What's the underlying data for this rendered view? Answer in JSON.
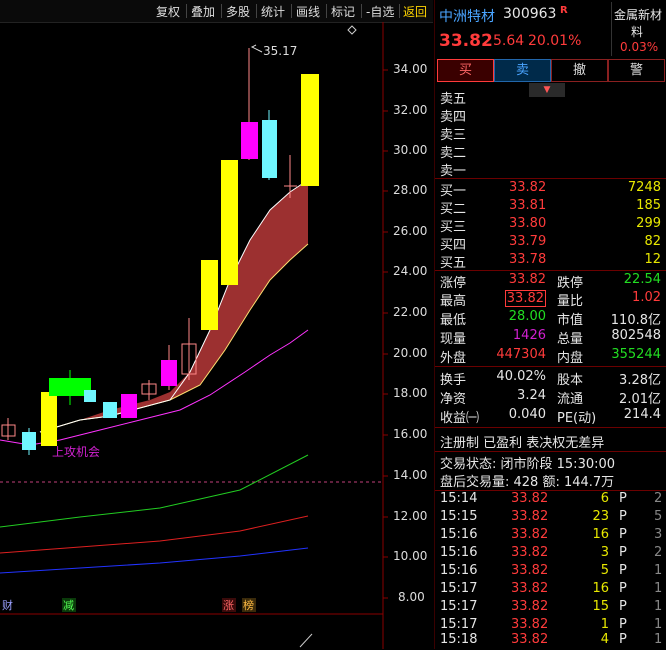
{
  "toolbar": {
    "items": [
      "复权",
      "叠加",
      "多股",
      "统计",
      "画线",
      "标记",
      "-自选",
      "返回"
    ]
  },
  "chart": {
    "y_ticks": [
      "34.00",
      "32.00",
      "30.00",
      "28.00",
      "26.00",
      "24.00",
      "22.00",
      "20.00",
      "18.00",
      "16.00",
      "14.00",
      "12.00",
      "10.00",
      "8.00"
    ],
    "high_marker": "35.17",
    "signal_text": "上攻机会",
    "bottom_tags": [
      "财",
      "减",
      "涨",
      "榜"
    ],
    "colors": {
      "yellow": "#ffff00",
      "magenta": "#ff00ff",
      "cyan": "#6ff6ff",
      "green": "#00ff00",
      "band": "#9c3030"
    }
  },
  "stock": {
    "name": "中洲特材",
    "code": "300963",
    "flag": "R",
    "price": "33.82",
    "change": "5.64",
    "change_pct": "20.01%",
    "sector_line1": "金属新材",
    "sector_line2": "料",
    "sector_pct": "0.03%"
  },
  "trade_buttons": [
    "买",
    "卖",
    "撤",
    "警"
  ],
  "sell_levels": [
    {
      "label": "卖五"
    },
    {
      "label": "卖四"
    },
    {
      "label": "卖三"
    },
    {
      "label": "卖二"
    },
    {
      "label": "卖一"
    }
  ],
  "buy_levels": [
    {
      "label": "买一",
      "price": "33.82",
      "vol": "7248"
    },
    {
      "label": "买二",
      "price": "33.81",
      "vol": "185"
    },
    {
      "label": "买三",
      "price": "33.80",
      "vol": "299"
    },
    {
      "label": "买四",
      "price": "33.79",
      "vol": "82"
    },
    {
      "label": "买五",
      "price": "33.78",
      "vol": "12"
    }
  ],
  "quote": {
    "zt_label": "涨停",
    "zt": "33.82",
    "dt_label": "跌停",
    "dt": "22.54",
    "high_label": "最高",
    "high": "33.82",
    "lb_label": "量比",
    "lb": "1.02",
    "low_label": "最低",
    "low": "28.00",
    "sz_label": "市值",
    "sz": "110.8亿",
    "xl_label": "现量",
    "xl": "1426",
    "zl_label": "总量",
    "zl": "802548",
    "wp_label": "外盘",
    "wp": "447304",
    "np_label": "内盘",
    "np": "355244"
  },
  "fund": {
    "hs_label": "换手",
    "hs": "40.02%",
    "gb_label": "股本",
    "gb": "3.28亿",
    "jz_label": "净资",
    "jz": "3.24",
    "lt_label": "流通",
    "lt": "2.01亿",
    "sy_label": "收益㈠",
    "sy": "0.040",
    "pe_label": "PE(动)",
    "pe": "214.4"
  },
  "tags_line": "注册制 已盈利 表决权无差异",
  "status_line": "交易状态: 闭市阶段 15:30:00",
  "after_line": "盘后交易量: 428  额: 144.7万",
  "ticks": [
    {
      "t": "15:14",
      "p": "33.82",
      "v": "6",
      "d": "P",
      "n": "2"
    },
    {
      "t": "15:15",
      "p": "33.82",
      "v": "23",
      "d": "P",
      "n": "5"
    },
    {
      "t": "15:16",
      "p": "33.82",
      "v": "16",
      "d": "P",
      "n": "3"
    },
    {
      "t": "15:16",
      "p": "33.82",
      "v": "3",
      "d": "P",
      "n": "2"
    },
    {
      "t": "15:16",
      "p": "33.82",
      "v": "5",
      "d": "P",
      "n": "1"
    },
    {
      "t": "15:17",
      "p": "33.82",
      "v": "16",
      "d": "P",
      "n": "1"
    },
    {
      "t": "15:17",
      "p": "33.82",
      "v": "15",
      "d": "P",
      "n": "1"
    },
    {
      "t": "15:17",
      "p": "33.82",
      "v": "1",
      "d": "P",
      "n": "1"
    },
    {
      "t": "15:18",
      "p": "33.82",
      "v": "4",
      "d": "P",
      "n": "1"
    }
  ]
}
